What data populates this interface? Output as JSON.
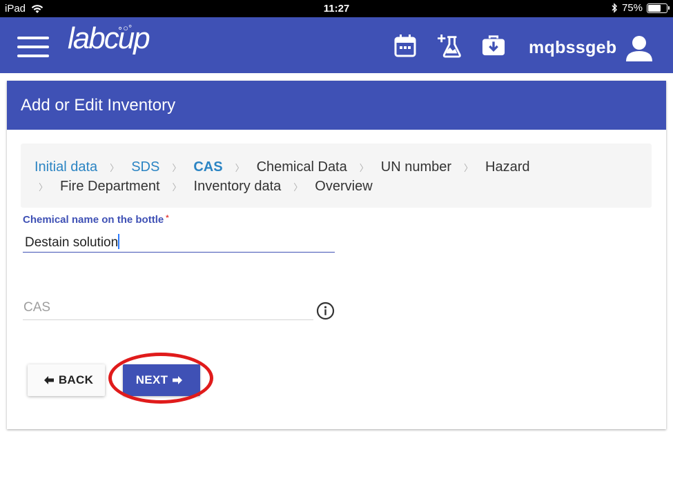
{
  "status_bar": {
    "device": "iPad",
    "time": "11:27",
    "battery": "75%",
    "battery_level": 0.75
  },
  "app": {
    "logo": "labcup",
    "username": "mqbssgeb",
    "brand_color": "#3f51b5"
  },
  "icons": {
    "menu": "hamburger-menu-icon",
    "calendar": "calendar-icon",
    "flask_add": "flask-add-icon",
    "medkit_download": "briefcase-download-icon",
    "user": "user-icon",
    "info": "info-icon"
  },
  "page": {
    "title": "Add or Edit Inventory"
  },
  "breadcrumb": {
    "row1": [
      {
        "label": "Initial data",
        "state": "done"
      },
      {
        "label": "SDS",
        "state": "done"
      },
      {
        "label": "CAS",
        "state": "active"
      },
      {
        "label": "Chemical Data",
        "state": "pending"
      },
      {
        "label": "UN number",
        "state": "pending"
      },
      {
        "label": "Hazard",
        "state": "pending"
      }
    ],
    "row2": [
      {
        "label": "Fire Department",
        "state": "pending"
      },
      {
        "label": "Inventory data",
        "state": "pending"
      },
      {
        "label": "Overview",
        "state": "pending"
      }
    ],
    "separator": "〉"
  },
  "form": {
    "chemical_name_label": "Chemical name on the bottle",
    "required_mark": "*",
    "chemical_name_value": "Destain solution",
    "cas_placeholder": "CAS"
  },
  "buttons": {
    "back_label": "BACK",
    "next_label": "NEXT"
  },
  "annotation": {
    "color": "#e01b1b",
    "target": "next-button"
  }
}
